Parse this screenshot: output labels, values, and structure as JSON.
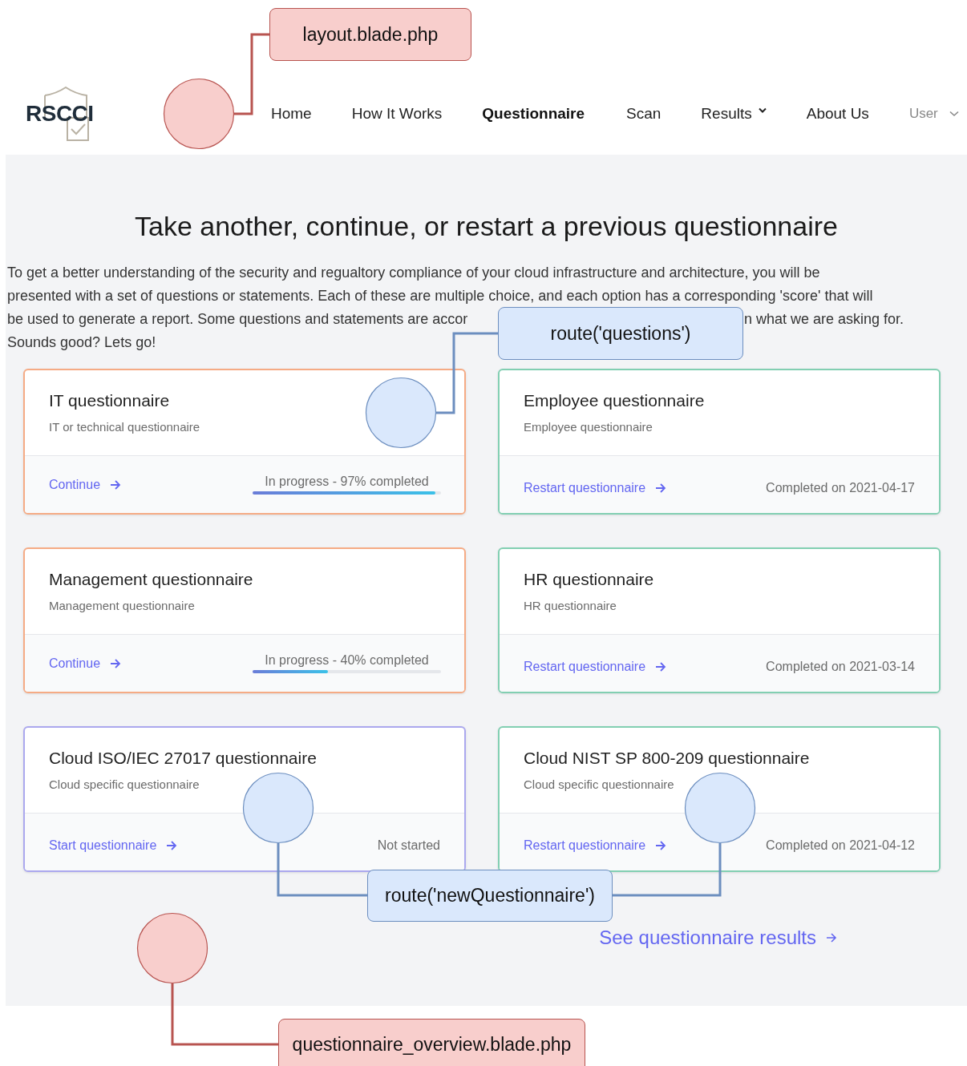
{
  "header": {
    "logo": "RSCCI",
    "nav": [
      {
        "label": "Home",
        "selected": false,
        "kind": "link"
      },
      {
        "label": "How It Works",
        "selected": false,
        "kind": "link"
      },
      {
        "label": "Questionnaire",
        "selected": true,
        "kind": "link"
      },
      {
        "label": "Scan",
        "selected": false,
        "kind": "link"
      },
      {
        "label": "Results",
        "selected": false,
        "kind": "dropdown"
      },
      {
        "label": "About Us",
        "selected": false,
        "kind": "link"
      },
      {
        "label": "User",
        "selected": false,
        "kind": "user"
      }
    ]
  },
  "main": {
    "title": "Take another, continue, or restart a previous questionnaire",
    "intro": [
      "To get a better understanding of the security and regualtory compliance of your cloud infrastructure and architecture, you will be",
      "presented with a set of questions or statements. Each of these are multiple choice, and each option has a corresponding 'score' that will",
      "be used to generate a report. Some questions and statements are accor",
      "n what we are asking for.",
      "Sounds good? Lets go!"
    ],
    "cards": [
      {
        "title": "IT questionnaire",
        "subtitle": "IT or technical questionnaire",
        "action": "Continue",
        "kind": "in_progress",
        "status": "In progress - 97% completed",
        "level": 0.97
      },
      {
        "title": "Employee questionnaire",
        "subtitle": "Employee questionnaire",
        "action": "Restart questionnaire",
        "kind": "completed",
        "status": "Completed on 2021-04-17"
      },
      {
        "title": "Management questionnaire",
        "subtitle": "Management questionnaire",
        "action": "Continue",
        "kind": "in_progress",
        "status": "In progress - 40% completed",
        "level": 0.4
      },
      {
        "title": "HR questionnaire",
        "subtitle": "HR questionnaire",
        "action": "Restart questionnaire",
        "kind": "completed",
        "status": "Completed on 2021-03-14"
      },
      {
        "title": "Cloud ISO/IEC 27017 questionnaire",
        "subtitle": "Cloud specific questionnaire",
        "action": "Start questionnaire",
        "kind": "not_started",
        "status": "Not started"
      },
      {
        "title": "Cloud NIST SP 800-209 questionnaire",
        "subtitle": "Cloud specific questionnaire",
        "action": "Restart questionnaire",
        "kind": "completed",
        "status": "Completed on 2021-04-12"
      }
    ],
    "results_link": "See questionnaire results"
  },
  "annotations": [
    {
      "label": "layout.blade.php",
      "color": "#f8cecc"
    },
    {
      "label": "route('questions')",
      "color": "#dae8fc"
    },
    {
      "label": "route('newQuestionnaire')",
      "color": "#dae8fc"
    },
    {
      "label": "questionnaire_overview.blade.php",
      "color": "#f8cecc"
    }
  ]
}
